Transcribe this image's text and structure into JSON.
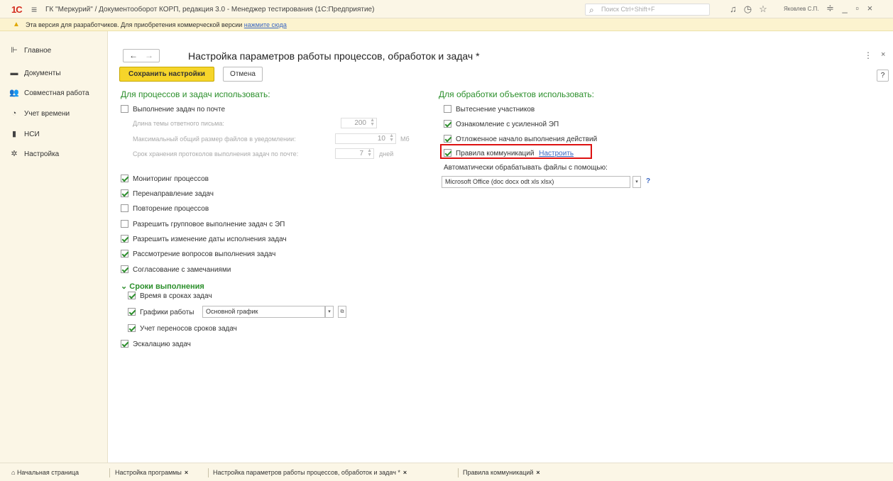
{
  "app": {
    "logo": "1С",
    "title": "ГК \"Меркурий\" / Документооборот КОРП, редакция 3.0 - Менеджер тестирования (1С:Предприятие)",
    "search_placeholder": "Поиск Ctrl+Shift+F",
    "user": "Яковлев С.П."
  },
  "warning": {
    "text": "Эта версия для разработчиков. Для приобретения коммерческой версии",
    "link": "нажмите сюда"
  },
  "sidebar": {
    "items": [
      {
        "label": "Главное",
        "icon": "home-icon"
      },
      {
        "label": "Документы",
        "icon": "folder-icon"
      },
      {
        "label": "Совместная работа",
        "icon": "people-icon"
      },
      {
        "label": "Учет времени",
        "icon": "clock-icon"
      },
      {
        "label": "НСИ",
        "icon": "book-icon"
      },
      {
        "label": "Настройка",
        "icon": "gear-icon"
      }
    ]
  },
  "page": {
    "title": "Настройка параметров работы процессов, обработок и задач *",
    "save_label": "Сохранить настройки",
    "cancel_label": "Отмена",
    "help_label": "?"
  },
  "left_section": {
    "header": "Для процессов и задач использовать:",
    "mail_tasks": {
      "label": "Выполнение задач по почте",
      "checked": false
    },
    "reply_length": {
      "label": "Длина темы ответного письма:",
      "value": "200"
    },
    "max_size": {
      "label": "Максимальный общий размер файлов в уведомлении:",
      "value": "10",
      "unit": "Мб"
    },
    "log_term": {
      "label": "Срок хранения протоколов выполнения задач по почте:",
      "value": "7",
      "unit": "дней"
    },
    "options": [
      {
        "label": "Мониторинг процессов",
        "checked": true
      },
      {
        "label": "Перенаправление задач",
        "checked": true
      },
      {
        "label": "Повторение процессов",
        "checked": false
      },
      {
        "label": "Разрешить групповое выполнение задач с ЭП",
        "checked": false
      },
      {
        "label": "Разрешить изменение даты исполнения задач",
        "checked": true
      },
      {
        "label": "Рассмотрение вопросов выполнения задач",
        "checked": true
      },
      {
        "label": "Согласование с замечаниями",
        "checked": true
      }
    ],
    "deadlines": {
      "header": "Сроки выполнения",
      "time_in_terms": {
        "label": "Время в сроках задач",
        "checked": true
      },
      "schedules": {
        "label": "Графики работы",
        "checked": true,
        "value": "Основной график"
      },
      "transfers": {
        "label": "Учет переносов сроков задач",
        "checked": true
      }
    },
    "escalation": {
      "label": "Эскалацию задач",
      "checked": true
    }
  },
  "right_section": {
    "header": "Для обработки объектов использовать:",
    "options": [
      {
        "label": "Вытеснение участников",
        "checked": false
      },
      {
        "label": "Ознакомление с усиленной ЭП",
        "checked": true
      },
      {
        "label": "Отложенное начало выполнения действий",
        "checked": true
      }
    ],
    "comm_rules": {
      "label": "Правила коммуникаций",
      "checked": true,
      "link": "Настроить"
    },
    "auto_files_label": "Автоматически обрабатывать файлы с помощью:",
    "auto_files_value": "Microsoft Office (doc docx odt xls xlsx)",
    "auto_files_help": "?"
  },
  "tabs": [
    {
      "label": "Начальная страница",
      "closable": false
    },
    {
      "label": "Настройка программы",
      "closable": true
    },
    {
      "label": "Настройка параметров работы процессов, обработок и задач *",
      "closable": true
    },
    {
      "label": "Правила коммуникаций",
      "closable": true
    }
  ],
  "colors": {
    "accent": "#f6d52a",
    "section": "#2b8f2b",
    "link": "#3a67c2",
    "highlight": "#dd1111"
  }
}
